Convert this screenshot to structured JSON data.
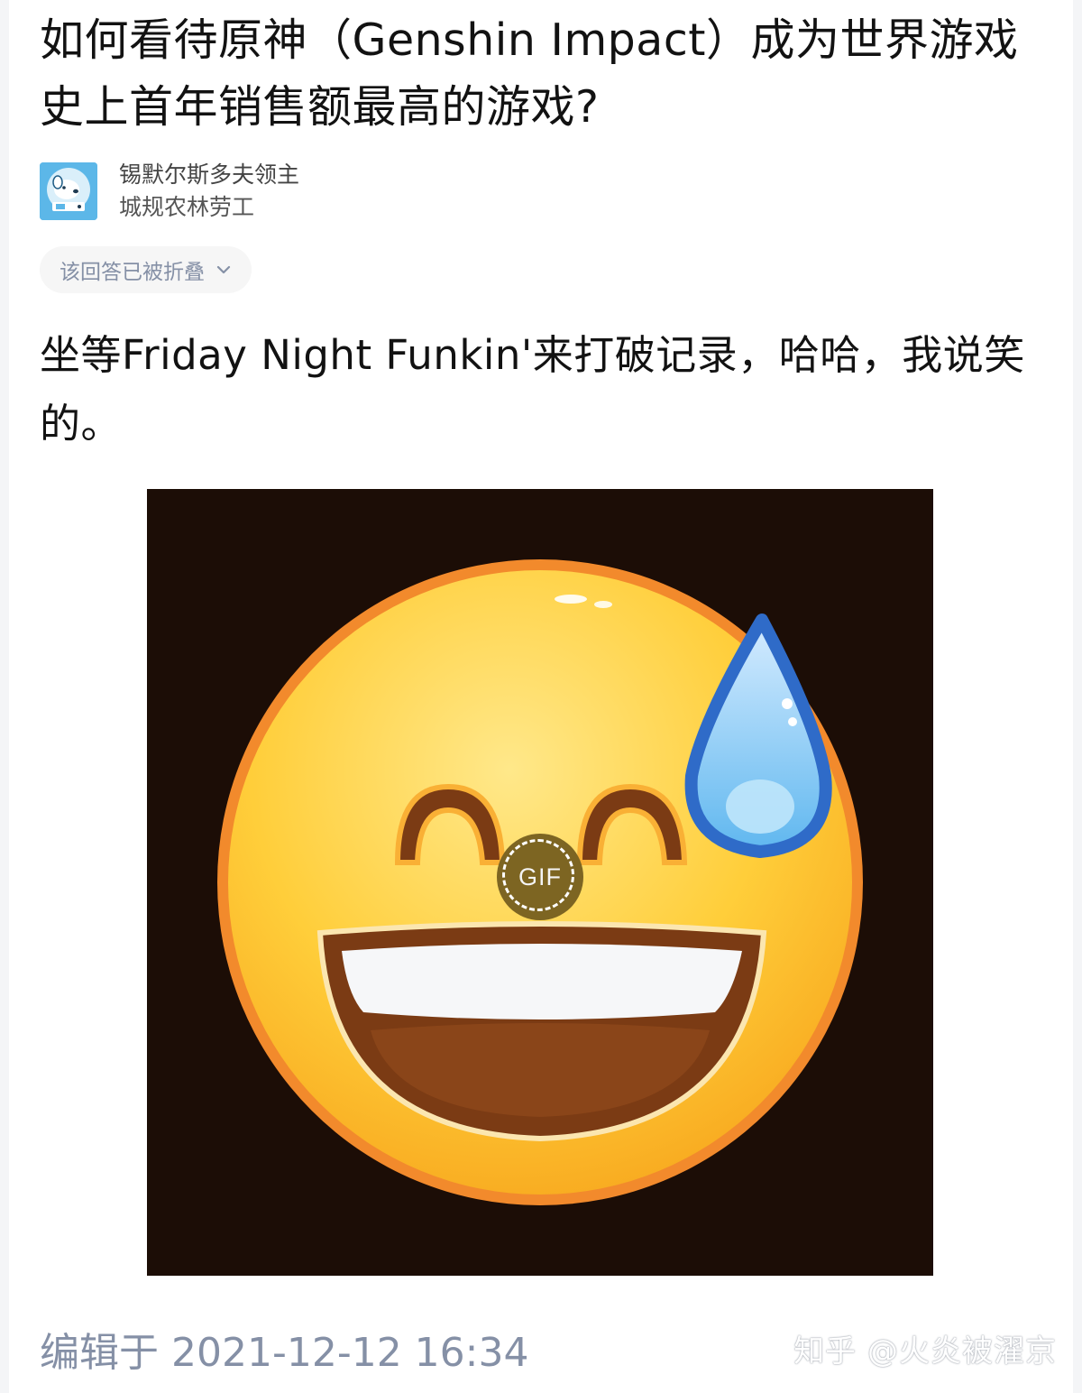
{
  "question": {
    "title": "如何看待原神（Genshin Impact）成为世界游戏史上首年销售额最高的游戏?"
  },
  "author": {
    "name": "锡默尔斯多夫领主",
    "headline": "城规农林劳工",
    "avatar_icon": "dog-avatar-icon"
  },
  "collapse": {
    "label": "该回答已被折叠",
    "icon": "chevron-down-icon"
  },
  "answer": {
    "text": "坐等Friday Night Funkin'来打破记录，哈哈，我说笑的。"
  },
  "media": {
    "type_badge": "GIF",
    "content": "smiling-face-with-sweat-emoji",
    "background_color": "#1c0d06"
  },
  "footer": {
    "edited": "编辑于 2021-12-12 16:34",
    "watermark": "知乎 @火炎被濯京"
  },
  "colors": {
    "text": "#121212",
    "muted": "#8590a6",
    "pill_bg": "#f6f6f6",
    "avatar_bg": "#5cb7e8"
  }
}
